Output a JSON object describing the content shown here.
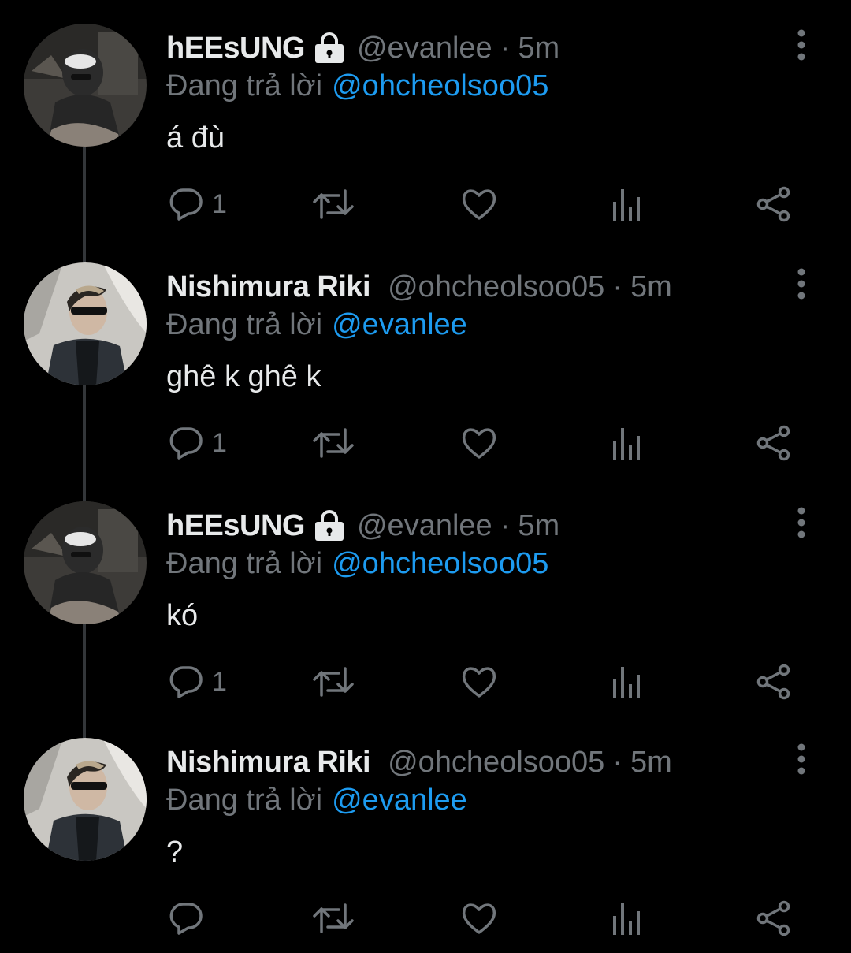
{
  "colors": {
    "background": "#000000",
    "primary_text": "#e7e9ea",
    "secondary_text": "#71767b",
    "mention_blue": "#1d9bf0",
    "thread_line": "#333639"
  },
  "icons": {
    "lock": "lock-icon",
    "more": "more-vertical-icon",
    "reply": "reply-icon",
    "retweet": "retweet-icon",
    "like": "heart-icon",
    "views": "analytics-icon",
    "share": "share-icon"
  },
  "tweets": [
    {
      "display_name": "hEEsUNG",
      "protected": true,
      "handle": "@evanlee",
      "separator": "·",
      "time": "5m",
      "reply_prefix": "Đang trả lời",
      "reply_to": "@ohcheolsoo05",
      "text": "á đù",
      "reply_count": "1"
    },
    {
      "display_name": "Nishimura Riki",
      "protected": false,
      "handle": "@ohcheolsoo05",
      "separator": "·",
      "time": "5m",
      "reply_prefix": "Đang trả lời",
      "reply_to": "@evanlee",
      "text": "ghê k ghê k",
      "reply_count": "1"
    },
    {
      "display_name": "hEEsUNG",
      "protected": true,
      "handle": "@evanlee",
      "separator": "·",
      "time": "5m",
      "reply_prefix": "Đang trả lời",
      "reply_to": "@ohcheolsoo05",
      "text": "kó",
      "reply_count": "1"
    },
    {
      "display_name": "Nishimura Riki",
      "protected": false,
      "handle": "@ohcheolsoo05",
      "separator": "·",
      "time": "5m",
      "reply_prefix": "Đang trả lời",
      "reply_to": "@evanlee",
      "text": "?",
      "reply_count": ""
    }
  ]
}
